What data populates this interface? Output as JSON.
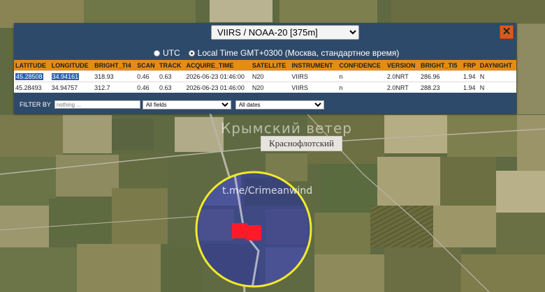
{
  "satellite_selector": {
    "value": "VIIRS / NOAA-20 [375m]"
  },
  "close_button": {
    "label": "✕"
  },
  "timezone": {
    "utc_label": "UTC",
    "local_label": "Local Time GMT+0300 (Москва, стандартное время)",
    "selected": "local"
  },
  "table": {
    "columns": [
      "LATITUDE",
      "LONGITUDE",
      "BRIGHT_TI4",
      "SCAN",
      "TRACK",
      "ACQUIRE_TIME",
      "SATELLITE",
      "INSTRUMENT",
      "CONFIDENCE",
      "VERSION",
      "BRIGHT_TI5",
      "FRP",
      "DAYNIGHT"
    ],
    "rows": [
      [
        "45.28508",
        "34.94161",
        "318.93",
        "0.46",
        "0.63",
        "2026-06-23 01:46:00",
        "N20",
        "VIIRS",
        "n",
        "2.0NRT",
        "286.96",
        "1.94",
        "N"
      ],
      [
        "45.28493",
        "34.94757",
        "312.7",
        "0.46",
        "0.63",
        "2026-06-23 01:46:00",
        "N20",
        "VIIRS",
        "n",
        "2.0NRT",
        "288.23",
        "1.94",
        "N"
      ]
    ]
  },
  "filter": {
    "label": "FILTER BY",
    "placeholder": "nothing ...",
    "field_select": "All fields",
    "date_select": "All dates"
  },
  "map": {
    "place_label": "Краснофлотский",
    "watermark_1": "Крымский ветер",
    "watermark_2": "t.me/Crimeanwind",
    "highlight_circle_color": "#f2ea2a",
    "hotspot_color": "#ff1a2a"
  }
}
